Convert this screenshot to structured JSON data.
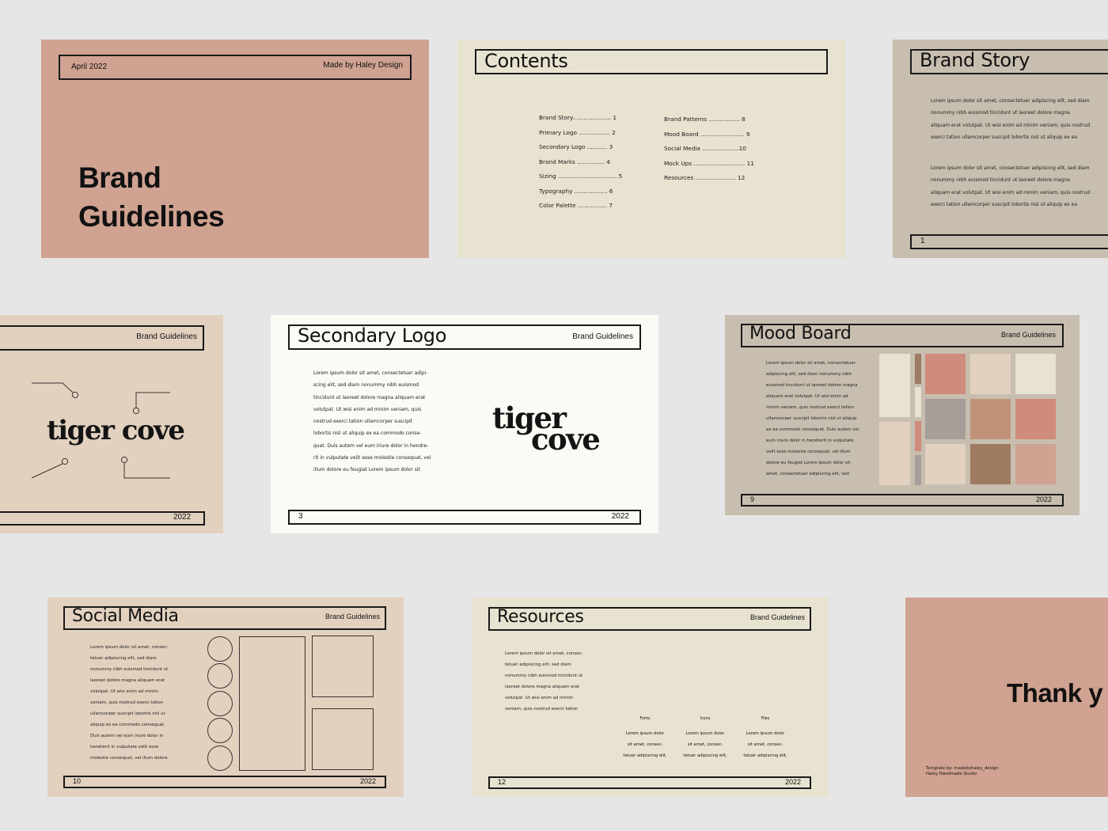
{
  "colors": {
    "page_bg": "#e6e6e6",
    "rose": "#d0a291",
    "cream": "#e8e2d0",
    "taupe": "#c8beaf",
    "sand": "#e2d1bf",
    "offwhite": "#fcfaf5",
    "ink": "#111111"
  },
  "cover": {
    "date": "April 2022",
    "made_by": "Made by Haley Design",
    "title_line1": "Brand",
    "title_line2": "Guidelines"
  },
  "contents": {
    "title": "Contents",
    "col1": [
      "Brand Story..................... 1",
      "Primary Logo ................. 2",
      "Secondary Logo ........... 3",
      "Brand Marks ............... 4",
      "Sizing ................................ 5",
      "Typography .................. 6",
      "Color Palette ................ 7"
    ],
    "col2": [
      "Brand Patterns ................. 8",
      "Mood Board ........................ 9",
      "Social Media ....................10",
      "Mock Ups ............................ 11",
      "Resources  ...................... 12"
    ]
  },
  "brand_story": {
    "title": "Brand Story",
    "para1": [
      "Lorem ipsum dolor sit amet, consectetuer adipiscing elit, sed diam",
      "nonummy nibh euismod tincidunt ut laoreet dolore magna",
      "aliquam erat volutpat. Ut wisi enim ad minim veniam, quis nostrud",
      "exerci tation ullamcorper suscipit lobortis nisl ut aliquip ex ea"
    ],
    "para2": [
      "Lorem ipsum dolor sit amet, consectetuer adipiscing elit, sed diam",
      "nonummy nibh euismod tincidunt ut laoreet dolore magna",
      "aliquam erat volutpat. Ut wisi enim ad minim veniam, quis nostrud",
      "exerci tation ullamcorper suscipit lobortis nisl ut aliquip ex ea"
    ],
    "page": "1"
  },
  "primary_logo": {
    "header_right": "Brand Guidelines",
    "logo": "tiger cove",
    "year": "2022"
  },
  "secondary_logo": {
    "title": "Secondary Logo",
    "header_right": "Brand Guidelines",
    "body": [
      "Lorem ipsum dolor sit amet, consectetuer adipi-",
      "scing elit, sed diam nonummy nibh euismod",
      "tincidunt ut laoreet dolore magna aliquam erat",
      "volutpat. Ut wisi enim ad minim veniam, quis",
      "nostrud exerci tation ullamcorper suscipit",
      "lobortis nisl ut aliquip ex ea commodo conse-",
      "quat. Duis autem vel eum iriure dolor in hendre-",
      "rit in vulputate velit esse molestie consequat, vel",
      "illum dolore eu feugiat Lorem ipsum dolor sit"
    ],
    "logo_line1": "tiger",
    "logo_line2": "cove",
    "page": "3",
    "year": "2022"
  },
  "mood_board": {
    "title": "Mood Board",
    "header_right": "Brand Guidelines",
    "body": [
      "Lorem ipsum dolor sit amet, consectetuer",
      "adipiscing elit, sed diam nonummy nibh",
      "euismod tincidunt ut laoreet dolore magna",
      "aliquam erat volutpat. Ut wisi enim ad",
      "minim veniam, quis nostrud exerci tation",
      "ullamcorper suscipit lobortis nisl ut aliquip",
      "ex ea commodo consequat. Duis autem vel",
      "eum iriure dolor in hendrerit in vulputate",
      "velit esse molestie consequat, vel illum",
      "dolore eu feugiat Lorem ipsum dolor sit",
      "amet, consectetuer adipiscing elit, sed"
    ],
    "swatches": {
      "tall_top": "#e8e2d0",
      "tall_bottom": "#e2d1bf",
      "strip1": "#9e7a62",
      "strip2": "#e8e2d0",
      "strip3": "#cf8b7c",
      "strip4": "#a69e98",
      "grid": [
        "#cf8b7c",
        "#e2d1bf",
        "#e8e2d0",
        "#a69e98",
        "#c09379",
        "#cf8b7c",
        "#e2d1bf",
        "#9e7a62",
        "#d0a291"
      ]
    },
    "page": "9",
    "year": "2022"
  },
  "social_media": {
    "title": "Social Media",
    "header_right": "Brand Guidelines",
    "body": [
      "Lorem ipsum dolor sit amet, consec-",
      "tetuer adipiscing elit, sed diam",
      "nonummy nibh euismod tincidunt ut",
      "laoreet dolore magna aliquam erat",
      "volutpat. Ut wisi enim ad minim",
      "veniam, quis nostrud exerci tation",
      "ullamcorper suscipit lobortis nisl ut",
      "aliquip ex ea commodo consequat.",
      "Duis autem vel eum iriure dolor in",
      "hendrerit in vulputate velit esse",
      "molestie consequat, vel illum dolore"
    ],
    "page": "10",
    "year": "2022"
  },
  "resources": {
    "title": "Resources",
    "header_right": "Brand Guidelines",
    "body": [
      "Lorem ipsum dolor sit amet, consec-",
      "tetuer adipiscing elit, sed diam",
      "nonummy nibh euismod tincidunt ut",
      "laoreet dolore magna aliquam erat",
      "volutpat. Ut wisi enim ad minim",
      "veniam, quis nostrud exerci tation"
    ],
    "columns": [
      {
        "label": "Fonts",
        "lines": [
          "Lorem ipsum dolor",
          "sit amet, consec-",
          "tetuer adipiscing elit,"
        ]
      },
      {
        "label": "Icons",
        "lines": [
          "Lorem ipsum dolor",
          "sit amet, consec-",
          "tetuer adipiscing elit,"
        ]
      },
      {
        "label": "Files",
        "lines": [
          "Lorem ipsum dolor",
          "sit amet, consec-",
          "tetuer adipiscing elit,"
        ]
      }
    ],
    "page": "12",
    "year": "2022"
  },
  "thank_you": {
    "title": "Thank y",
    "credit_line1": "Template by: madebyhaley_design",
    "credit_line2": "Haley Handmade Studio"
  }
}
